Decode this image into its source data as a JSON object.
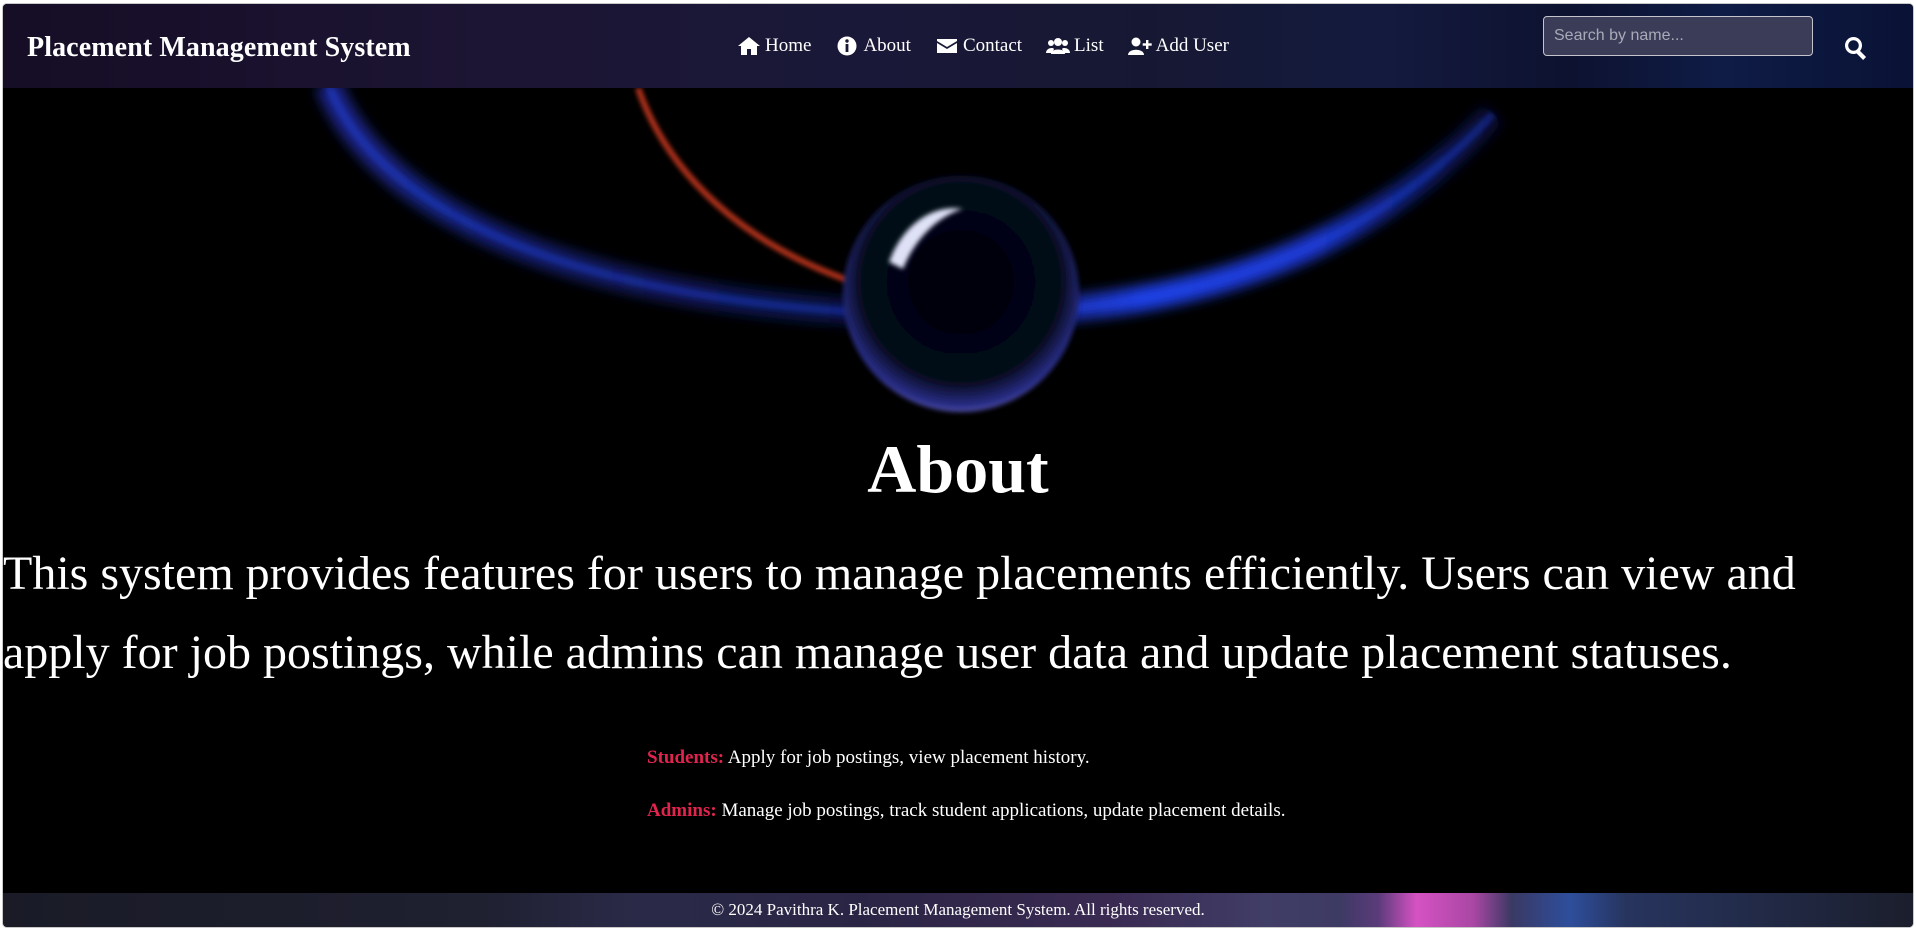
{
  "navbar": {
    "brand": "Placement Management System",
    "links": [
      {
        "label": "Home",
        "icon": "home-icon"
      },
      {
        "label": "About",
        "icon": "info-circle-icon"
      },
      {
        "label": "Contact",
        "icon": "envelope-icon"
      },
      {
        "label": "List",
        "icon": "users-icon"
      },
      {
        "label": "Add User",
        "icon": "user-plus-icon"
      }
    ],
    "search": {
      "placeholder": "Search by name...",
      "value": "",
      "icon": "search-icon"
    }
  },
  "main": {
    "title": "About",
    "description": "This system provides features for users to manage placements efficiently. Users can view and apply for job postings, while admins can manage user data and update placement statuses.",
    "roles": [
      {
        "name": "Students:",
        "text": "Apply for job postings, view placement history."
      },
      {
        "name": "Admins:",
        "text": "Manage job postings, track student applications, update placement details."
      }
    ]
  },
  "footer": {
    "text": "© 2024 Pavithra K. Placement Management System. All rights reserved."
  },
  "colors": {
    "background": "#000000",
    "role_accent": "#e0244e",
    "text": "#ffffff"
  }
}
